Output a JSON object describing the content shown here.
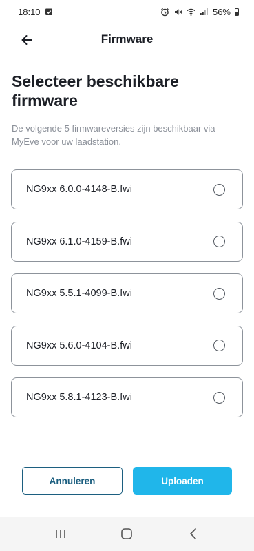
{
  "status_bar": {
    "time": "18:10",
    "battery": "56%",
    "icons": [
      "calendar-check-icon",
      "alarm-icon",
      "mute-icon",
      "wifi-icon",
      "signal-icon",
      "battery-icon"
    ]
  },
  "app_bar": {
    "title": "Firmware",
    "back_icon": "arrow-left-icon"
  },
  "content": {
    "heading": "Selecteer beschikbare firmware",
    "description": "De volgende 5 firmwareversies zijn beschikbaar via MyEve voor uw laadstation."
  },
  "firmware_options": [
    {
      "label": "NG9xx 6.0.0-4148-B.fwi",
      "selected": false
    },
    {
      "label": "NG9xx 6.1.0-4159-B.fwi",
      "selected": false
    },
    {
      "label": "NG9xx 5.5.1-4099-B.fwi",
      "selected": false
    },
    {
      "label": "NG9xx 5.6.0-4104-B.fwi",
      "selected": false
    },
    {
      "label": "NG9xx 5.8.1-4123-B.fwi",
      "selected": false
    }
  ],
  "actions": {
    "cancel_label": "Annuleren",
    "upload_label": "Uploaden"
  },
  "colors": {
    "accent": "#20b6ea",
    "secondary": "#1c5f80",
    "border": "#8d939b",
    "muted_text": "#8a8f98"
  },
  "nav_bar": {
    "icons": [
      "recent-apps-icon",
      "home-icon",
      "back-nav-icon"
    ]
  }
}
